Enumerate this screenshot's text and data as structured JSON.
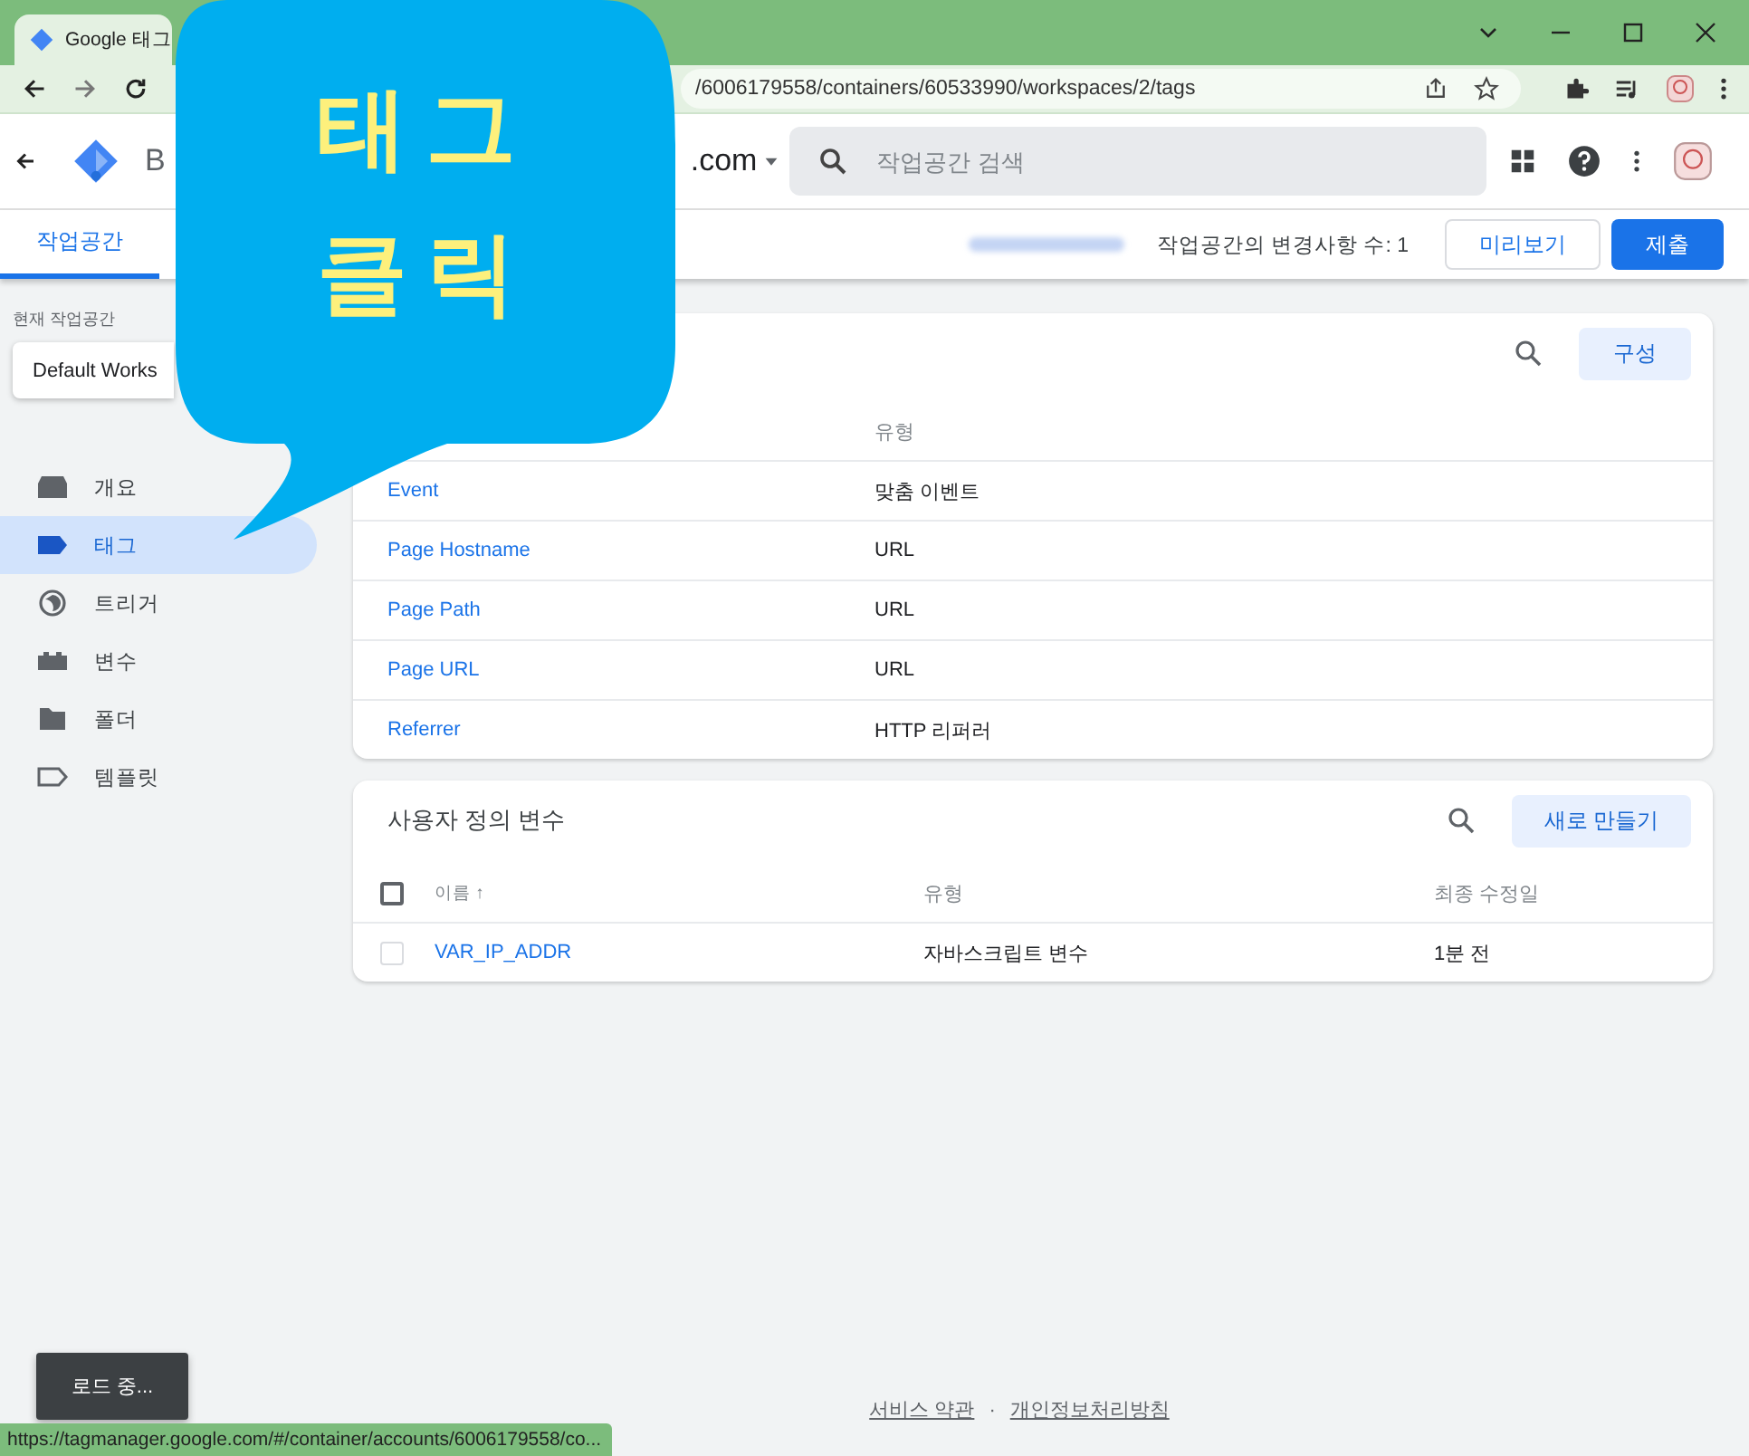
{
  "browser": {
    "tab_title": "Google 태그",
    "url": "/6006179558/containers/60533990/workspaces/2/tags",
    "status_url": "https://tagmanager.google.com/#/container/accounts/6006179558/co..."
  },
  "header": {
    "account_initial": "B",
    "container_tail": ".com",
    "search": {
      "placeholder": "작업공간 검색"
    }
  },
  "subheader": {
    "tabs": [
      {
        "label": "작업공간",
        "selected": true
      }
    ],
    "changes": "작업공간의 변경사항 수: 1",
    "buttons": [
      {
        "label": "미리보기",
        "kind": "outline"
      },
      {
        "label": "제출",
        "kind": "primary"
      }
    ]
  },
  "sidebar": {
    "workspace_label": "현재 작업공간",
    "workspace": "Default Works",
    "items": [
      {
        "label": "개요",
        "selected": false
      },
      {
        "label": "태그",
        "selected": true
      },
      {
        "label": "트리거",
        "selected": false
      },
      {
        "label": "변수",
        "selected": false
      },
      {
        "label": "폴더",
        "selected": false
      },
      {
        "label": "템플릿",
        "selected": false
      }
    ]
  },
  "builtin_vars": {
    "button": "구성",
    "type_header": "유형",
    "rows": [
      {
        "name": "Event",
        "type": "맞춤 이벤트"
      },
      {
        "name": "Page Hostname",
        "type": "URL"
      },
      {
        "name": "Page Path",
        "type": "URL"
      },
      {
        "name": "Page URL",
        "type": "URL"
      },
      {
        "name": "Referrer",
        "type": "HTTP 리퍼러"
      }
    ]
  },
  "user_vars": {
    "title": "사용자 정의 변수",
    "button": "새로 만들기",
    "all_checked": false,
    "columns": [
      "이름 ↑",
      "유형",
      "최종 수정일"
    ],
    "rows": [
      {
        "name": "VAR_IP_ADDR",
        "type": "자바스크립트 변수",
        "modified": "1분 전",
        "checked": false
      }
    ]
  },
  "footer": {
    "links": [
      "서비스 약관",
      "개인정보처리방침"
    ],
    "separator": "·"
  },
  "snackbar": "로드 중...",
  "callout": {
    "lines": [
      "태그",
      "클릭"
    ]
  }
}
